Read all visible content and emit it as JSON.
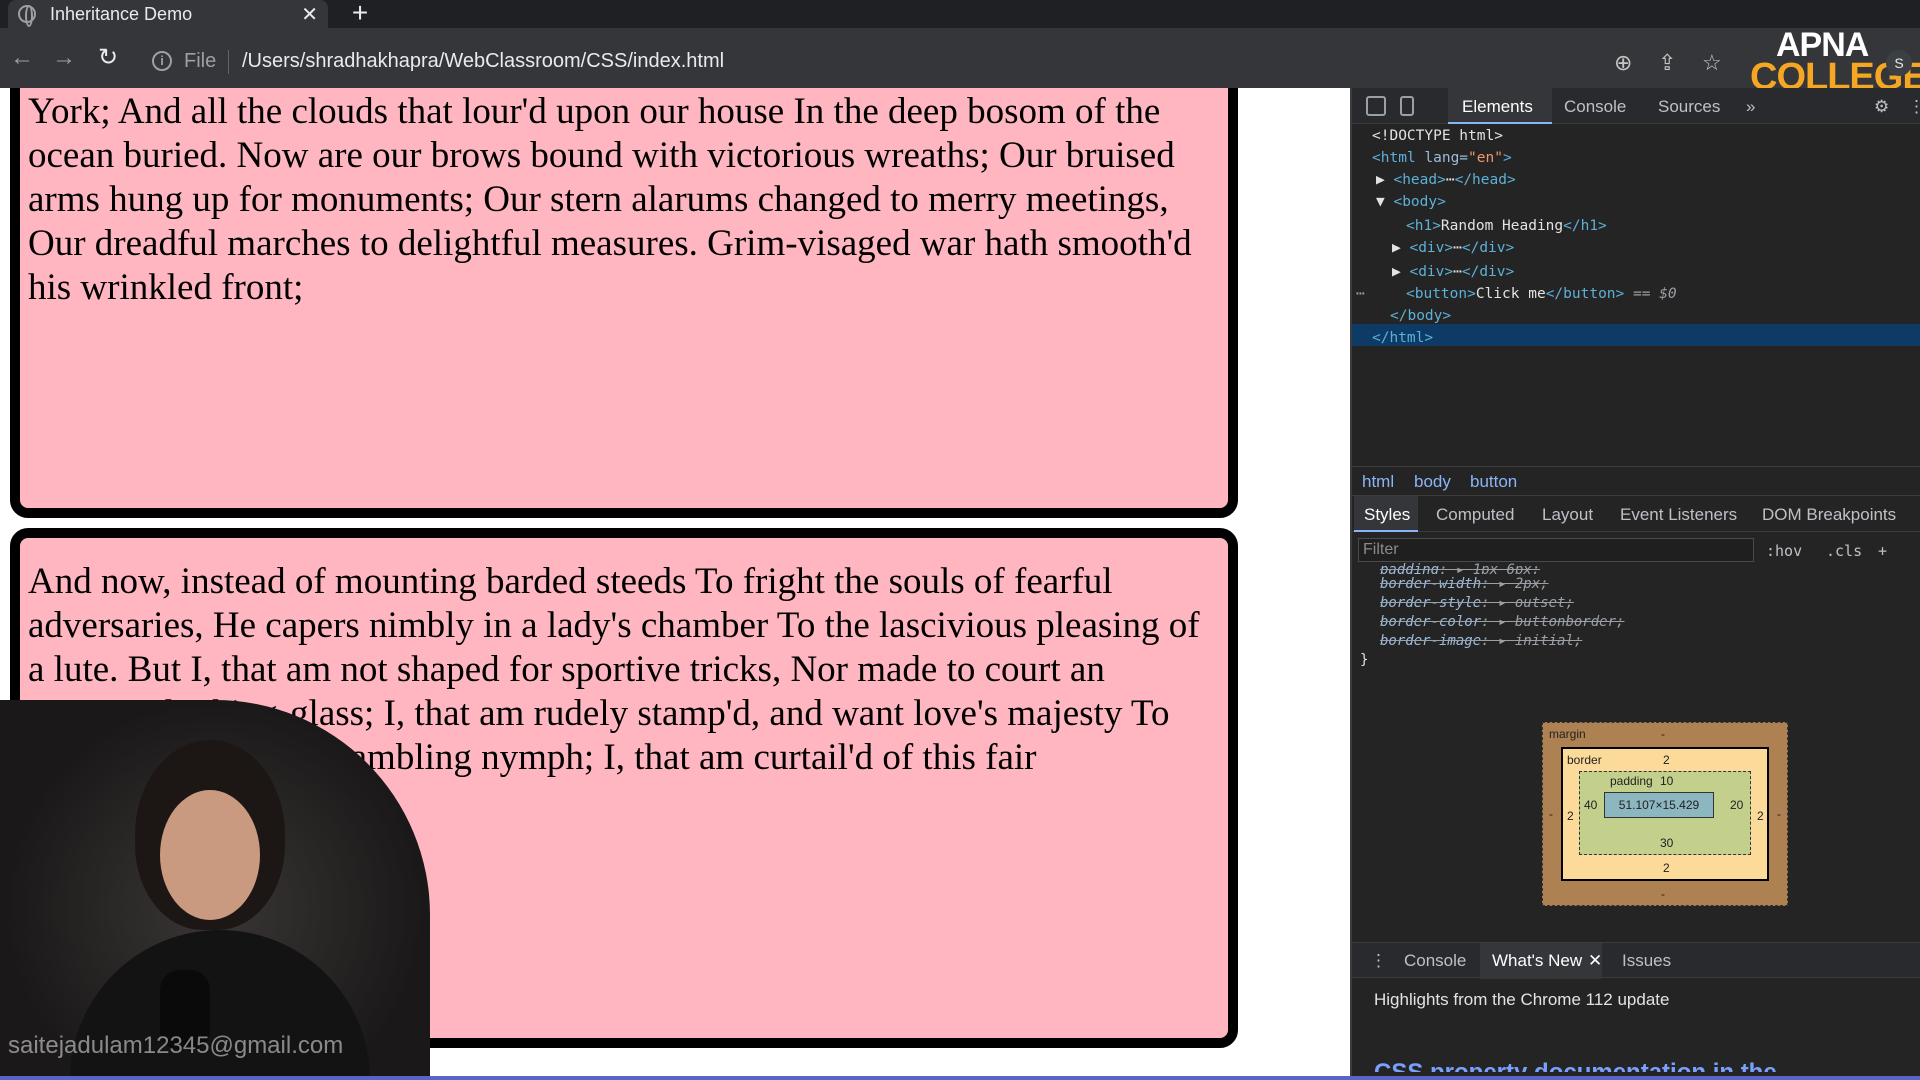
{
  "browser": {
    "tab_title": "Inheritance Demo",
    "tab_close": "✕",
    "new_tab": "+",
    "scheme": "File",
    "url": "/Users/shradhakhapra/WebClassroom/CSS/index.html",
    "profile_initial": "S",
    "logo_line1": "APNA",
    "logo_line2": "COLLEGE"
  },
  "page": {
    "paragraph1": "York; And all the clouds that lour'd upon our house In the deep bosom of the ocean buried. Now are our brows bound with victorious wreaths; Our bruised arms hung up for monuments; Our stern alarums changed to merry meetings, Our dreadful marches to delightful measures. Grim-visaged war hath smooth'd his wrinkled front;",
    "paragraph2": "And now, instead of mounting barded steeds To fright the souls of fearful adversaries, He capers nimbly in a lady's chamber To the lascivious pleasing of a lute. But I, that am not shaped for sportive tricks, Nor made to court an amorous looking-glass; I, that am rudely stamp'd, and want love's majesty To strut before a wanton ambling nymph; I, that am curtail'd of this fair",
    "watermark": "saitejadulam12345@gmail.com",
    "box_background": "#ffb6c1"
  },
  "devtools": {
    "tabs": [
      "Elements",
      "Console",
      "Sources",
      "»"
    ],
    "dom": {
      "doctype": "<!DOCTYPE html>",
      "html_open_tag": "<html ",
      "html_attr": "lang=",
      "html_attr_value": "\"en\"",
      "html_open_end": ">",
      "head": "<head>",
      "head_ellipsis": "⋯",
      "head_close": "</head>",
      "body_open": "<body>",
      "h1_open": "<h1>",
      "h1_text": "Random Heading",
      "h1_close": "</h1>",
      "div_open": "<div>",
      "div_ellipsis": "⋯",
      "div_close": "</div>",
      "button_open": "<button>",
      "button_text": "Click me",
      "button_close": "</button>",
      "selected_marker": "== $0",
      "body_close": "</body>",
      "html_close": "</html>",
      "row_dots": "⋯"
    },
    "breadcrumbs": [
      "html",
      "body",
      "button"
    ],
    "subtabs": [
      "Styles",
      "Computed",
      "Layout",
      "Event Listeners",
      "DOM Breakpoints"
    ],
    "filter_placeholder": "Filter",
    "filter_buttons": [
      ":hov",
      ".cls",
      "+"
    ],
    "css_rules": [
      {
        "prop": "padding",
        "value": "1px 6px;"
      },
      {
        "prop": "border-width",
        "value": "2px;"
      },
      {
        "prop": "border-style",
        "value": "outset;"
      },
      {
        "prop": "border-color",
        "value": "buttonborder;"
      },
      {
        "prop": "border-image",
        "value": "initial;"
      }
    ],
    "css_close": "}",
    "box_model": {
      "margin_label": "margin",
      "margin_value": "-",
      "border_label": "border",
      "border_top": "2",
      "border_left": "2",
      "border_right": "2",
      "border_bottom": "2",
      "padding_label": "padding",
      "padding_top": "10",
      "padding_left": "40",
      "padding_right": "20",
      "padding_bottom": "30",
      "content_size": "51.107×15.429",
      "margin_left": "-",
      "margin_right": "-",
      "margin_bottom": "-"
    },
    "drawer_tabs": [
      "Console",
      "What's New",
      "Issues"
    ],
    "drawer_close": "✕",
    "highlights": "Highlights from the Chrome 112 update",
    "cut_heading": "CSS property documentation in the"
  }
}
